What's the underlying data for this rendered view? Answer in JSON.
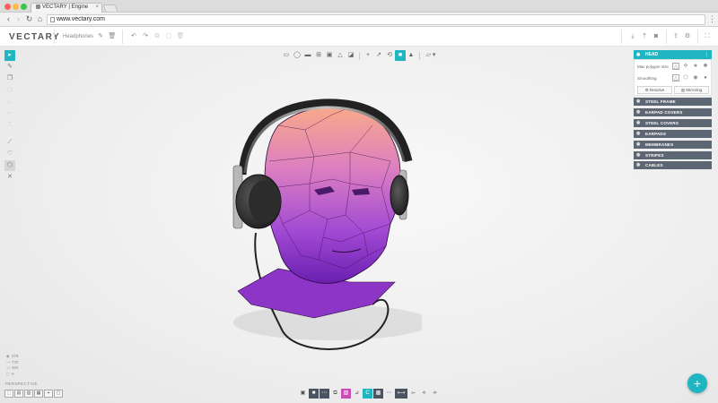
{
  "browser": {
    "tab_title": "VECTARY | Engine",
    "tab_close": "×",
    "url": "www.vectary.com",
    "nav": {
      "back": "‹",
      "forward": "›",
      "reload": "↻",
      "home": "⌂",
      "menu": "⋮"
    }
  },
  "app": {
    "logo": "VECTARY",
    "project_name": "Headphones",
    "header_icons": [
      "pencil-icon",
      "trash-icon",
      "undo-icon",
      "redo-icon",
      "copy-icon",
      "paste-icon",
      "download-icon",
      "upload-icon",
      "camera-icon",
      "share-icon",
      "settings-icon",
      "fullscreen-icon"
    ]
  },
  "glyphs": {
    "pencil": "✎",
    "trash": "🗑",
    "undo": "↶",
    "redo": "↷",
    "copy": "⧉",
    "paste": "▢",
    "download": "⤓",
    "upload": "⤒",
    "camera": "◙",
    "share": "⇪",
    "settings": "⚙",
    "fullscreen": "⛶",
    "eye": "◉",
    "more": "⋮",
    "plus": "+"
  },
  "top_toolbar": {
    "tools": [
      "▭",
      "◯",
      "▬",
      "⊞",
      "▣",
      "△",
      "◪",
      "+",
      "↗",
      "⟲",
      "■",
      "▲",
      "▱ ▾"
    ]
  },
  "left_toolbar": {
    "tools": [
      "▸",
      "✎",
      "❐",
      "◻",
      "∟",
      "⌐",
      "⎍",
      "⟋",
      "♡",
      "⬡",
      "✕"
    ]
  },
  "stats": [
    {
      "icon": "◆",
      "value": "376"
    },
    {
      "icon": "—",
      "value": "770"
    },
    {
      "icon": "◁",
      "value": "404"
    },
    {
      "icon": "◻",
      "value": "0"
    }
  ],
  "camera_mode": "PERSPECTIVE",
  "view_buttons": [
    "⬚",
    "▤",
    "▥",
    "▦",
    "⌖",
    "▢"
  ],
  "bottom_toolbar": [
    "▣",
    "■",
    "⋯",
    "⧉",
    "▧",
    "⊿",
    "C",
    "▩",
    "⋯",
    "⟷",
    "⟜",
    "⟡",
    "⟢"
  ],
  "fab_label": "+",
  "panel": {
    "active_layer": "HEAD",
    "max_polygon_label": "Max polygon size",
    "smoothing_label": "Smoothing",
    "max_polygon_icons": [
      "△",
      "✣",
      "★",
      "✺"
    ],
    "smoothing_icons": [
      "△",
      "⬡",
      "◉",
      "●"
    ],
    "resolve_label": "Resolve",
    "mirroring_label": "Mirroring",
    "resolve_icon": "⚙",
    "mirroring_icon": "▥",
    "layers": [
      "STEEL FRAME",
      "EARPAD COVERS",
      "STEEL COVERS",
      "EARPADS",
      "MEMBRANES",
      "STRIPES",
      "CABLES"
    ]
  },
  "colors": {
    "accent": "#1fb6c1",
    "layer_bg": "#5d6774",
    "model_top": "#f9a98a",
    "model_mid": "#b35ad4",
    "model_bottom": "#6a1fb0"
  }
}
